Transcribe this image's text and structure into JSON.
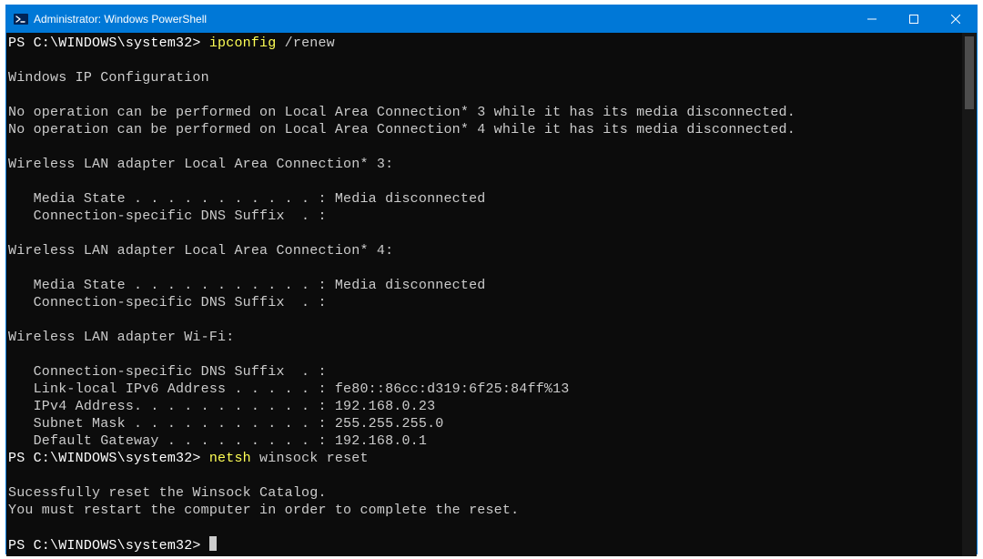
{
  "window": {
    "title": "Administrator: Windows PowerShell"
  },
  "session": {
    "prompt1": "PS C:\\WINDOWS\\system32> ",
    "cmd1_hl": "ipconfig",
    "cmd1_rest": " /renew",
    "output1": "\nWindows IP Configuration\n\nNo operation can be performed on Local Area Connection* 3 while it has its media disconnected.\nNo operation can be performed on Local Area Connection* 4 while it has its media disconnected.\n\nWireless LAN adapter Local Area Connection* 3:\n\n   Media State . . . . . . . . . . . : Media disconnected\n   Connection-specific DNS Suffix  . :\n\nWireless LAN adapter Local Area Connection* 4:\n\n   Media State . . . . . . . . . . . : Media disconnected\n   Connection-specific DNS Suffix  . :\n\nWireless LAN adapter Wi-Fi:\n\n   Connection-specific DNS Suffix  . :\n   Link-local IPv6 Address . . . . . : fe80::86cc:d319:6f25:84ff%13\n   IPv4 Address. . . . . . . . . . . : 192.168.0.23\n   Subnet Mask . . . . . . . . . . . : 255.255.255.0\n   Default Gateway . . . . . . . . . : 192.168.0.1",
    "prompt2": "PS C:\\WINDOWS\\system32> ",
    "cmd2_hl": "netsh",
    "cmd2_rest": " winsock reset",
    "output2": "\nSucessfully reset the Winsock Catalog.\nYou must restart the computer in order to complete the reset.\n",
    "prompt3": "PS C:\\WINDOWS\\system32> "
  }
}
